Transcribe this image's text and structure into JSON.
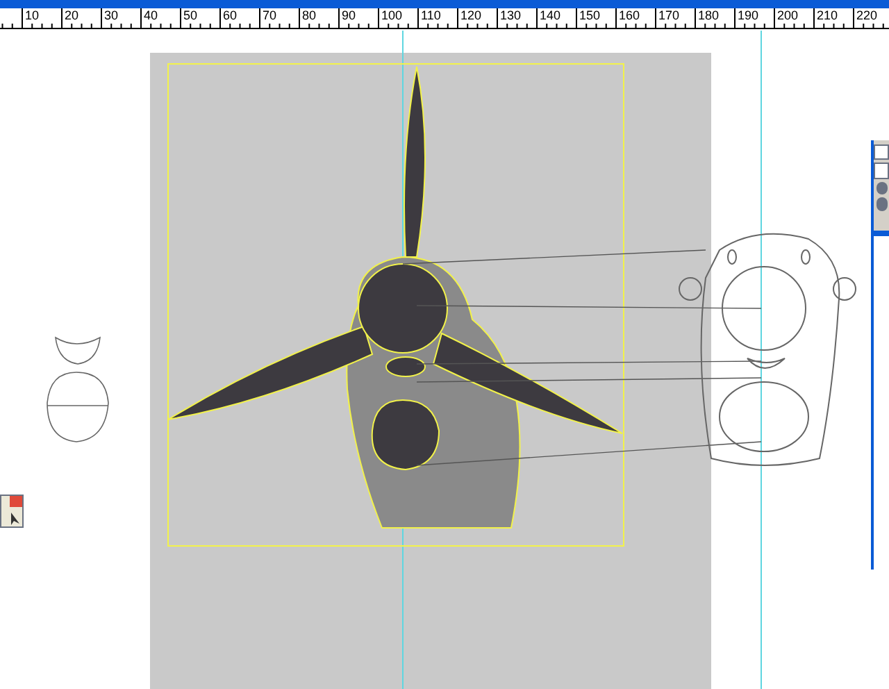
{
  "ruler": {
    "labels": [
      "10",
      "20",
      "30",
      "40",
      "50",
      "60",
      "70",
      "80",
      "90",
      "100",
      "110",
      "120",
      "130",
      "140",
      "150",
      "160",
      "170",
      "180",
      "190",
      "200",
      "210",
      "220"
    ]
  }
}
